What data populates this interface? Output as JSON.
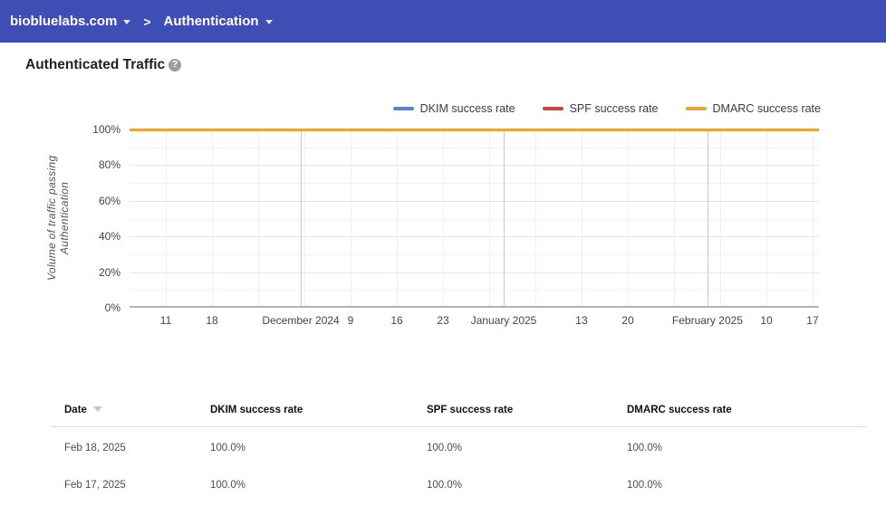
{
  "topbar": {
    "domain": "biobluelabs.com",
    "separator": "&gt;",
    "section": "Authentication",
    "bg_color": "#3e4eb5"
  },
  "page": {
    "title": "Authenticated Traffic"
  },
  "icons": {
    "help_glyph": "?"
  },
  "chart_data": {
    "type": "line",
    "title": "Authenticated Traffic",
    "xlabel": "",
    "ylabel": "Volume of traffic passing Authentication",
    "ylim": [
      0,
      100
    ],
    "yticks": [
      "0%",
      "20%",
      "40%",
      "60%",
      "80%",
      "100%"
    ],
    "grid": "on",
    "legend_position": "top-right",
    "x_range": [
      "2024-11-11",
      "2025-02-18"
    ],
    "xticks": [
      {
        "label": "11",
        "f": 0.0526
      },
      {
        "label": "18",
        "f": 0.1196
      },
      {
        "label": "",
        "f": 0.1866
      },
      {
        "label": "",
        "f": 0.2536
      },
      {
        "label": "9",
        "f": 0.3206
      },
      {
        "label": "16",
        "f": 0.3877
      },
      {
        "label": "23",
        "f": 0.4547
      },
      {
        "label": "",
        "f": 0.5217
      },
      {
        "label": "",
        "f": 0.5887
      },
      {
        "label": "13",
        "f": 0.6557
      },
      {
        "label": "20",
        "f": 0.7227
      },
      {
        "label": "",
        "f": 0.7898
      },
      {
        "label": "",
        "f": 0.8568
      },
      {
        "label": "10",
        "f": 0.9238
      },
      {
        "label": "17",
        "f": 0.9908
      }
    ],
    "month_labels": [
      {
        "label": "December 2024",
        "f": 0.2484
      },
      {
        "label": "January 2025",
        "f": 0.5427
      },
      {
        "label": "February 2025",
        "f": 0.8383
      }
    ],
    "series": [
      {
        "name": "DKIM success rate",
        "color": "#5b7fd6",
        "value_percent": 100
      },
      {
        "name": "SPF success rate",
        "color": "#ce4537",
        "value_percent": 100
      },
      {
        "name": "DMARC success rate",
        "color": "#e9a33c",
        "value_percent": 100
      }
    ]
  },
  "table": {
    "columns": [
      "Date",
      "DKIM success rate",
      "SPF success rate",
      "DMARC success rate"
    ],
    "rows": [
      {
        "date": "Feb 18, 2025",
        "dkim": "100.0%",
        "spf": "100.0%",
        "dmarc": "100.0%"
      },
      {
        "date": "Feb 17, 2025",
        "dkim": "100.0%",
        "spf": "100.0%",
        "dmarc": "100.0%"
      }
    ]
  }
}
